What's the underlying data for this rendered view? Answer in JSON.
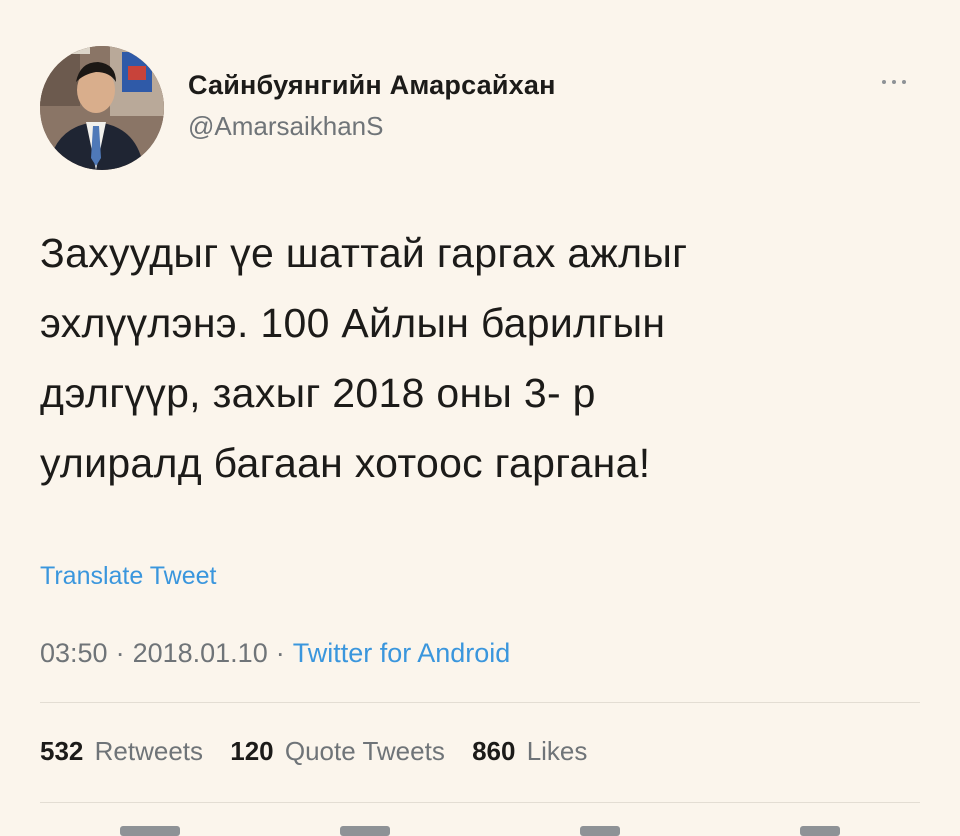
{
  "tweet": {
    "display_name": "Сайнбуянгийн Амарсайхан",
    "handle": "@AmarsaikhanS",
    "text": "Захуудыг үе шаттай гаргах ажлыг\nэхлүүлэнэ. 100 Айлын  барилгын\nдэлгүүр, захыг 2018 оны 3- р\nулиралд багаан хотоос гаргана!",
    "translate_label": "Translate Tweet",
    "time": "03:50",
    "separator": "·",
    "date": "2018.01.10",
    "source": "Twitter for Android"
  },
  "stats": {
    "retweets_count": "532",
    "retweets_label": "Retweets",
    "quotes_count": "120",
    "quotes_label": "Quote Tweets",
    "likes_count": "860",
    "likes_label": "Likes"
  },
  "icons": {
    "avatar": "profile-photo",
    "more": "more-options-icon"
  },
  "colors": {
    "background": "#fbf5ec",
    "text": "#1c1b19",
    "secondary": "#6f7478",
    "link": "#3a96dd"
  }
}
